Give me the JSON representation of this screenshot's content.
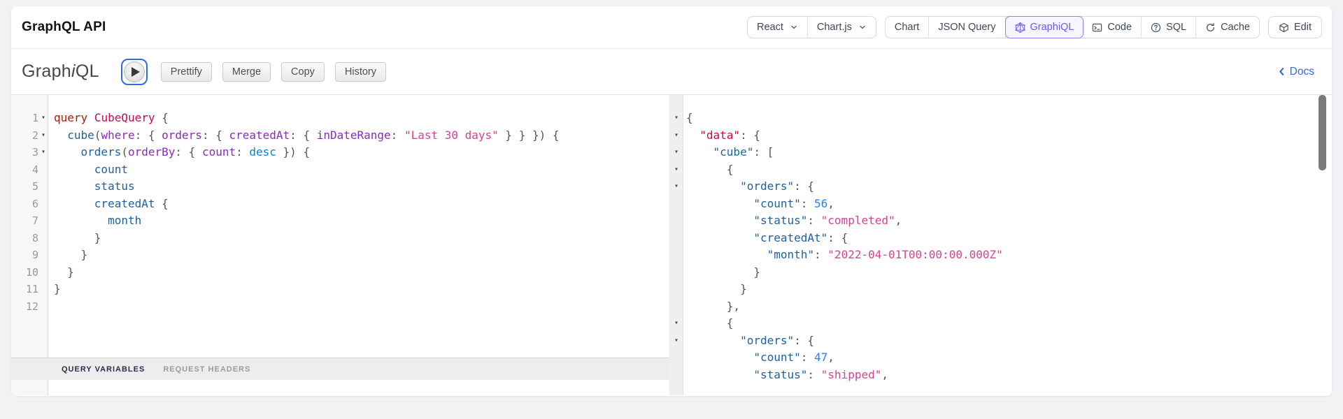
{
  "page": {
    "title": "GraphQL API"
  },
  "header": {
    "framework_select": {
      "value": "React",
      "icon": "chevron-down-icon"
    },
    "library_select": {
      "value": "Chart.js",
      "icon": "chevron-down-icon"
    },
    "tabs": [
      {
        "label": "Chart",
        "active": false
      },
      {
        "label": "JSON Query",
        "active": false
      },
      {
        "label": "GraphiQL",
        "icon": "graphql-icon",
        "active": true
      },
      {
        "label": "Code",
        "icon": "terminal-icon",
        "active": false
      },
      {
        "label": "SQL",
        "icon": "help-icon",
        "active": false
      },
      {
        "label": "Cache",
        "icon": "refresh-icon",
        "active": false
      }
    ],
    "edit_button": {
      "label": "Edit",
      "icon": "cube-icon"
    }
  },
  "graphiql": {
    "logo": {
      "pre": "Graph",
      "i": "i",
      "post": "QL"
    },
    "play_button": {
      "icon": "play-icon"
    },
    "toolbar_buttons": [
      "Prettify",
      "Merge",
      "Copy",
      "History"
    ],
    "docs_link": {
      "label": "Docs",
      "icon": "chevron-left-icon"
    },
    "variables_tabs": [
      {
        "label": "QUERY VARIABLES",
        "active": true
      },
      {
        "label": "REQUEST HEADERS",
        "active": false
      }
    ],
    "query_lines": [
      {
        "n": 1,
        "fold": true,
        "segs": [
          [
            "k",
            "query"
          ],
          [
            "p",
            " "
          ],
          [
            "d",
            "CubeQuery"
          ],
          [
            "p",
            " {"
          ]
        ]
      },
      {
        "n": 2,
        "fold": true,
        "segs": [
          [
            "p",
            "  "
          ],
          [
            "prop",
            "cube"
          ],
          [
            "p",
            "("
          ],
          [
            "attr",
            "where"
          ],
          [
            "p",
            ": { "
          ],
          [
            "attr",
            "orders"
          ],
          [
            "p",
            ": { "
          ],
          [
            "attr",
            "createdAt"
          ],
          [
            "p",
            ": { "
          ],
          [
            "attr",
            "inDateRange"
          ],
          [
            "p",
            ": "
          ],
          [
            "str",
            "\"Last 30 days\""
          ],
          [
            "p",
            " } } }) {"
          ]
        ]
      },
      {
        "n": 3,
        "fold": true,
        "segs": [
          [
            "p",
            "    "
          ],
          [
            "prop",
            "orders"
          ],
          [
            "p",
            "("
          ],
          [
            "attr",
            "orderBy"
          ],
          [
            "p",
            ": { "
          ],
          [
            "attr",
            "count"
          ],
          [
            "p",
            ": "
          ],
          [
            "enum",
            "desc"
          ],
          [
            "p",
            " }) {"
          ]
        ]
      },
      {
        "n": 4,
        "fold": false,
        "segs": [
          [
            "p",
            "      "
          ],
          [
            "prop",
            "count"
          ]
        ]
      },
      {
        "n": 5,
        "fold": false,
        "segs": [
          [
            "p",
            "      "
          ],
          [
            "prop",
            "status"
          ]
        ]
      },
      {
        "n": 6,
        "fold": false,
        "segs": [
          [
            "p",
            "      "
          ],
          [
            "prop",
            "createdAt"
          ],
          [
            "p",
            " {"
          ]
        ]
      },
      {
        "n": 7,
        "fold": false,
        "segs": [
          [
            "p",
            "        "
          ],
          [
            "prop",
            "month"
          ]
        ]
      },
      {
        "n": 8,
        "fold": false,
        "segs": [
          [
            "p",
            "      }"
          ]
        ]
      },
      {
        "n": 9,
        "fold": false,
        "segs": [
          [
            "p",
            "    }"
          ]
        ]
      },
      {
        "n": 10,
        "fold": false,
        "segs": [
          [
            "p",
            "  }"
          ]
        ]
      },
      {
        "n": 11,
        "fold": false,
        "segs": [
          [
            "p",
            "}"
          ]
        ]
      },
      {
        "n": 12,
        "fold": false,
        "segs": []
      }
    ],
    "result_lines": [
      {
        "fold": true,
        "segs": [
          [
            "p",
            "{"
          ]
        ]
      },
      {
        "fold": true,
        "segs": [
          [
            "p",
            "  "
          ],
          [
            "dkey",
            "\"data\""
          ],
          [
            "p",
            ": {"
          ]
        ]
      },
      {
        "fold": true,
        "segs": [
          [
            "p",
            "    "
          ],
          [
            "prop",
            "\"cube\""
          ],
          [
            "p",
            ": ["
          ]
        ]
      },
      {
        "fold": true,
        "segs": [
          [
            "p",
            "      {"
          ]
        ]
      },
      {
        "fold": true,
        "segs": [
          [
            "p",
            "        "
          ],
          [
            "prop",
            "\"orders\""
          ],
          [
            "p",
            ": {"
          ]
        ]
      },
      {
        "fold": false,
        "segs": [
          [
            "p",
            "          "
          ],
          [
            "prop",
            "\"count\""
          ],
          [
            "p",
            ": "
          ],
          [
            "num",
            "56"
          ],
          [
            "p",
            ","
          ]
        ]
      },
      {
        "fold": false,
        "segs": [
          [
            "p",
            "          "
          ],
          [
            "prop",
            "\"status\""
          ],
          [
            "p",
            ": "
          ],
          [
            "str",
            "\"completed\""
          ],
          [
            "p",
            ","
          ]
        ]
      },
      {
        "fold": false,
        "segs": [
          [
            "p",
            "          "
          ],
          [
            "prop",
            "\"createdAt\""
          ],
          [
            "p",
            ": {"
          ]
        ]
      },
      {
        "fold": false,
        "segs": [
          [
            "p",
            "            "
          ],
          [
            "prop",
            "\"month\""
          ],
          [
            "p",
            ": "
          ],
          [
            "str",
            "\"2022-04-01T00:00:00.000Z\""
          ]
        ]
      },
      {
        "fold": false,
        "segs": [
          [
            "p",
            "          }"
          ]
        ]
      },
      {
        "fold": false,
        "segs": [
          [
            "p",
            "        }"
          ]
        ]
      },
      {
        "fold": false,
        "segs": [
          [
            "p",
            "      },"
          ]
        ]
      },
      {
        "fold": true,
        "segs": [
          [
            "p",
            "      {"
          ]
        ]
      },
      {
        "fold": true,
        "segs": [
          [
            "p",
            "        "
          ],
          [
            "prop",
            "\"orders\""
          ],
          [
            "p",
            ": {"
          ]
        ]
      },
      {
        "fold": false,
        "segs": [
          [
            "p",
            "          "
          ],
          [
            "prop",
            "\"count\""
          ],
          [
            "p",
            ": "
          ],
          [
            "num",
            "47"
          ],
          [
            "p",
            ","
          ]
        ]
      },
      {
        "fold": false,
        "segs": [
          [
            "p",
            "          "
          ],
          [
            "prop",
            "\"status\""
          ],
          [
            "p",
            ": "
          ],
          [
            "str",
            "\"shipped\""
          ],
          [
            "p",
            ","
          ]
        ]
      }
    ]
  },
  "colors": {
    "page_background": "#f1f2f4",
    "tab_active_text": "#655cf0",
    "tab_active_border": "#8a82f6",
    "tab_active_background": "#f7f6ff",
    "docs_link_blue": "#2f6bd0",
    "play_button_border": "#2f6cdf",
    "token_keyword": "#B11A04",
    "token_def": "#D2054E",
    "token_property": "#1F61A0",
    "token_attribute": "#8B2BB9",
    "token_string": "#D64292",
    "token_enum": "#0B7FC7",
    "token_number": "#2882F9",
    "token_punctuation": "#555555"
  }
}
